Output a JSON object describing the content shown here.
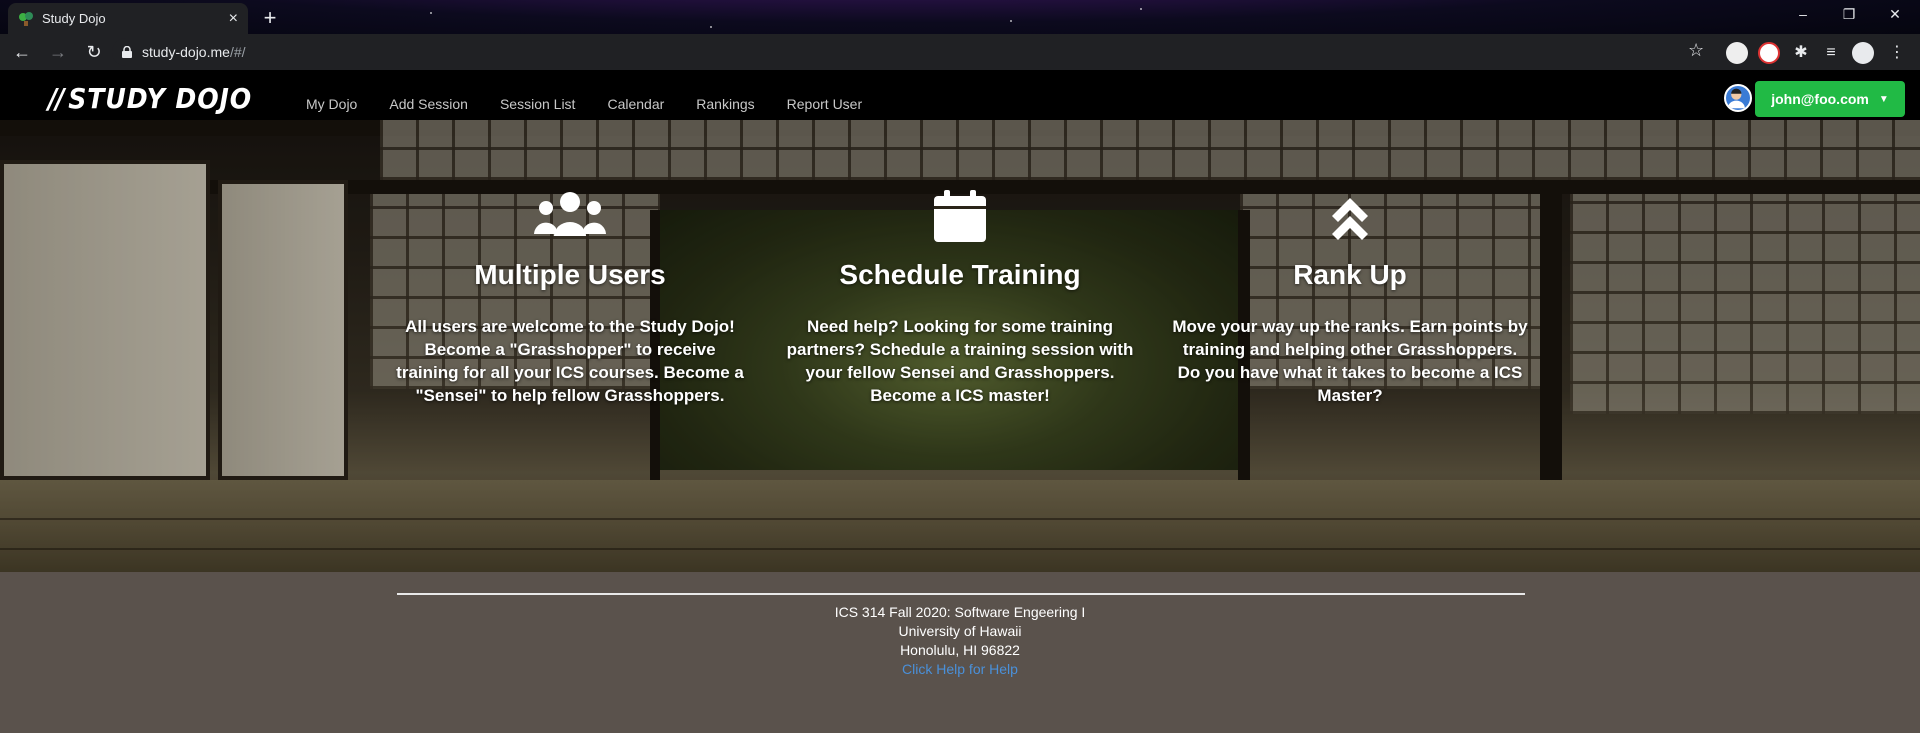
{
  "browser": {
    "tab_title": "Study Dojo",
    "url_host": "study-dojo.me",
    "url_path": "/#/"
  },
  "site": {
    "logo_text": "STUDY DOJO",
    "nav": [
      "My Dojo",
      "Add Session",
      "Session List",
      "Calendar",
      "Rankings",
      "Report User"
    ],
    "user_email": "john@foo.com"
  },
  "features": [
    {
      "icon": "users-icon",
      "title": "Multiple Users",
      "lines": [
        "All users are welcome to the Study Dojo!",
        "Become a \"Grasshopper\" to receive",
        "training for all your ICS courses. Become a",
        "\"Sensei\" to help fellow Grasshoppers."
      ]
    },
    {
      "icon": "calendar-icon",
      "title": "Schedule Training",
      "lines": [
        "Need help? Looking for some training",
        "partners? Schedule a training session with",
        "your fellow Sensei and Grasshoppers.",
        "Become a ICS master!"
      ]
    },
    {
      "icon": "chevrons-up-icon",
      "title": "Rank Up",
      "lines": [
        "Move your way up the ranks. Earn points by",
        "training and helping other Grasshoppers.",
        "Do you have what it takes to become a ICS",
        "Master?"
      ]
    }
  ],
  "footer": {
    "line1": "ICS 314 Fall 2020: Software Engeering I",
    "line2": "University of Hawaii",
    "line3": "Honolulu, HI 96822",
    "help_link": "Click Help for Help"
  },
  "colors": {
    "user_button": "#21ba45",
    "footer_bg": "#5a524c",
    "help_link": "#4a90d9"
  }
}
